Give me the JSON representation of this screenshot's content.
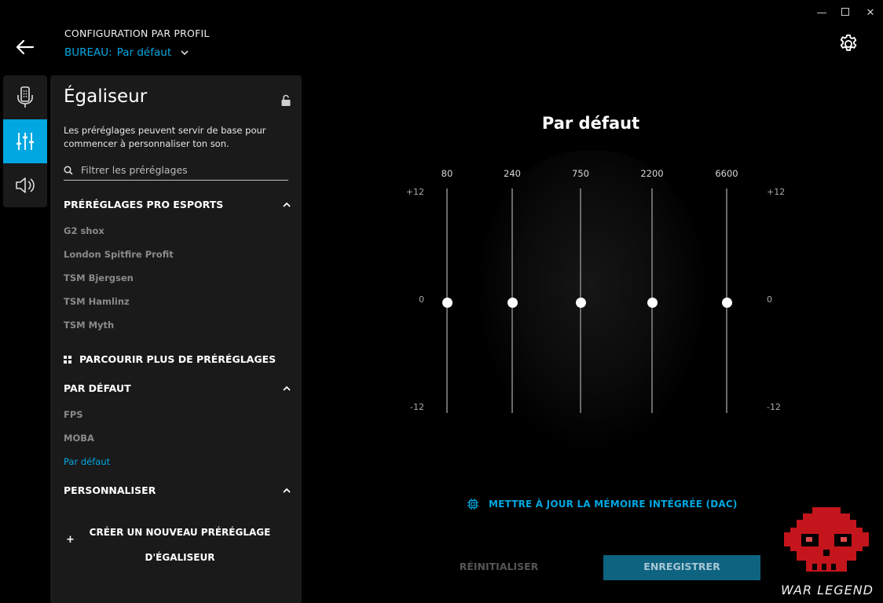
{
  "window": {
    "minimize": "—",
    "maximize": "",
    "close": "✕"
  },
  "header": {
    "profile_title": "CONFIGURATION PAR PROFIL",
    "profile_prefix": "BUREAU:",
    "profile_value": "Par défaut"
  },
  "rail": {
    "items": [
      {
        "icon": "microphone-icon",
        "active": false
      },
      {
        "icon": "equalizer-icon",
        "active": true
      },
      {
        "icon": "surround-sound-icon",
        "active": false
      }
    ]
  },
  "panel": {
    "title": "Égaliseur",
    "description": "Les préréglages peuvent servir de base pour commencer à personnaliser ton son.",
    "search_placeholder": "Filtrer les préréglages",
    "sections": {
      "pro": {
        "title": "PRÉRÉGLAGES PRO ESPORTS",
        "items": [
          "G2 shox",
          "London Spitfire Profit",
          "TSM Bjergsen",
          "TSM Hamlinz",
          "TSM Myth"
        ]
      },
      "browse_label": "PARCOURIR PLUS DE PRÉRÉGLAGES",
      "default": {
        "title": "PAR DÉFAUT",
        "items": [
          "FPS",
          "MOBA",
          "Par défaut"
        ],
        "selected": "Par défaut"
      },
      "custom": {
        "title": "PERSONNALISER",
        "create_plus": "+",
        "create_label": "CRÉER UN NOUVEAU PRÉRÉGLAGE D'ÉGALISEUR"
      }
    }
  },
  "eq": {
    "preset_name": "Par défaut",
    "scale": {
      "top": "+12",
      "mid": "0",
      "bottom": "-12"
    },
    "bands": [
      {
        "freq": "80",
        "gain_db": 0
      },
      {
        "freq": "240",
        "gain_db": 0
      },
      {
        "freq": "750",
        "gain_db": 0
      },
      {
        "freq": "2200",
        "gain_db": 0
      },
      {
        "freq": "6600",
        "gain_db": 0
      }
    ]
  },
  "actions": {
    "dac_label": "METTRE À JOUR LA MÉMOIRE INTÉGRÉE (DAC)",
    "reset_label": "RÉINITIALISER",
    "save_label": "ENREGISTRER"
  },
  "watermark": {
    "text": "WAR LEGEND"
  },
  "colors": {
    "accent": "#00a7e1",
    "panel": "#1a1a1a",
    "save_bg": "#0e6381"
  }
}
